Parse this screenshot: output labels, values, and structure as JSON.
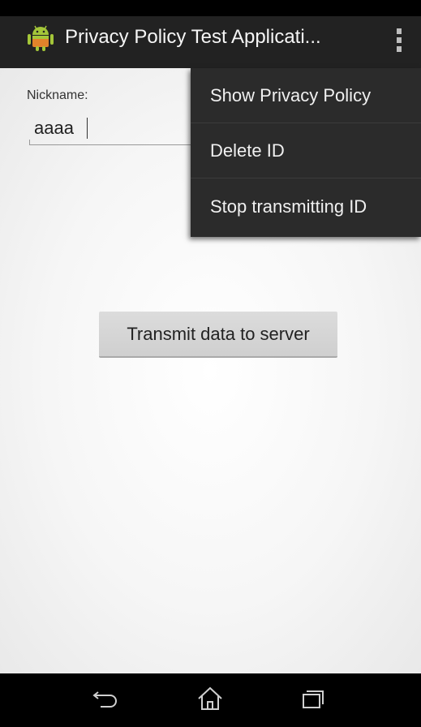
{
  "app": {
    "title": "Privacy Policy Test Applicati..."
  },
  "form": {
    "nickname_label": "Nickname:",
    "nickname_value": "aaaa",
    "transmit_button": "Transmit data to server"
  },
  "overflow_menu": {
    "items": [
      {
        "label": "Show Privacy Policy"
      },
      {
        "label": "Delete ID"
      },
      {
        "label": "Stop transmitting ID"
      }
    ]
  },
  "navigation": {
    "icons": [
      "back-icon",
      "home-icon",
      "recent-apps-icon"
    ]
  },
  "colors": {
    "action_bar": "#222222",
    "menu_background": "#2b2b2b",
    "android_green": "#a4c639",
    "button": "#d5d5d5"
  }
}
